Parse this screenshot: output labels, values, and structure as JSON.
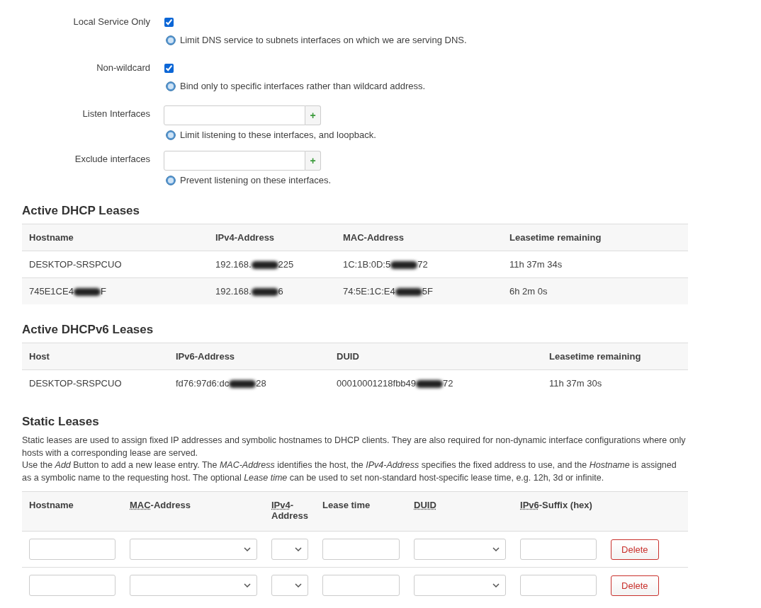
{
  "options": [
    {
      "kind": "checkbox",
      "label": "Local Service Only",
      "checked": true,
      "help": "Limit DNS service to subnets interfaces on which we are serving DNS."
    },
    {
      "kind": "checkbox",
      "label": "Non-wildcard",
      "checked": true,
      "help": "Bind only to specific interfaces rather than wildcard address."
    },
    {
      "kind": "dynlist",
      "label": "Listen Interfaces",
      "add": "+",
      "help": "Limit listening to these interfaces, and loopback."
    },
    {
      "kind": "dynlist",
      "label": "Exclude interfaces",
      "add": "+",
      "help": "Prevent listening on these interfaces."
    }
  ],
  "dhcp_leases": {
    "title": "Active DHCP Leases",
    "columns": [
      "Hostname",
      "IPv4-Address",
      "MAC-Address",
      "Leasetime remaining"
    ],
    "rows": [
      [
        {
          "before": "DESKTOP-SRSPCUO"
        },
        {
          "before": "192.168.",
          "redacted": true,
          "after": "225"
        },
        {
          "before": "1C:1B:0D:5",
          "redacted": true,
          "after": "72"
        },
        {
          "before": "11h 37m 34s"
        }
      ],
      [
        {
          "before": "745E1CE4",
          "redacted": true,
          "after": "F"
        },
        {
          "before": "192.168.",
          "redacted": true,
          "after": "6"
        },
        {
          "before": "74:5E:1C:E4",
          "redacted": true,
          "after": "5F"
        },
        {
          "before": "6h 2m 0s"
        }
      ]
    ]
  },
  "dhcpv6_leases": {
    "title": "Active DHCPv6 Leases",
    "columns": [
      "Host",
      "IPv6-Address",
      "DUID",
      "Leasetime remaining"
    ],
    "rows": [
      [
        {
          "before": "DESKTOP-SRSPCUO"
        },
        {
          "before": "fd76:97d6:dc",
          "redacted": true,
          "after": "28"
        },
        {
          "before": "00010001218fbb49",
          "redacted": true,
          "after": "72"
        },
        {
          "before": "11h 37m 30s"
        }
      ]
    ]
  },
  "static_leases": {
    "title": "Static Leases",
    "description": [
      "Static leases are used to assign fixed IP addresses and symbolic hostnames to DHCP clients. They are also required for non-dynamic interface configurations where only hosts with a corresponding lease are served.",
      "Use the *Add* Button to add a new lease entry. The *MAC-Address* identifies the host, the *IPv4-Address* specifies the fixed address to use, and the *Hostname* is assigned as a symbolic name to the requesting host. The optional *Lease time* can be used to set non-standard host-specific lease time, e.g. 12h, 3d or infinite."
    ],
    "columns": [
      {
        "label": "Hostname",
        "kind": "text"
      },
      {
        "abbr": "MAC",
        "label": "-Address",
        "kind": "select"
      },
      {
        "abbr": "IPv4",
        "label": "-Address",
        "kind": "select"
      },
      {
        "label": "Lease time",
        "kind": "text"
      },
      {
        "abbr": "DUID",
        "kind": "select"
      },
      {
        "abbr": "IPv6",
        "label": "-Suffix (hex)",
        "kind": "text"
      }
    ],
    "rows": [
      {
        "delete": "Delete"
      },
      {
        "delete": "Delete"
      }
    ]
  }
}
